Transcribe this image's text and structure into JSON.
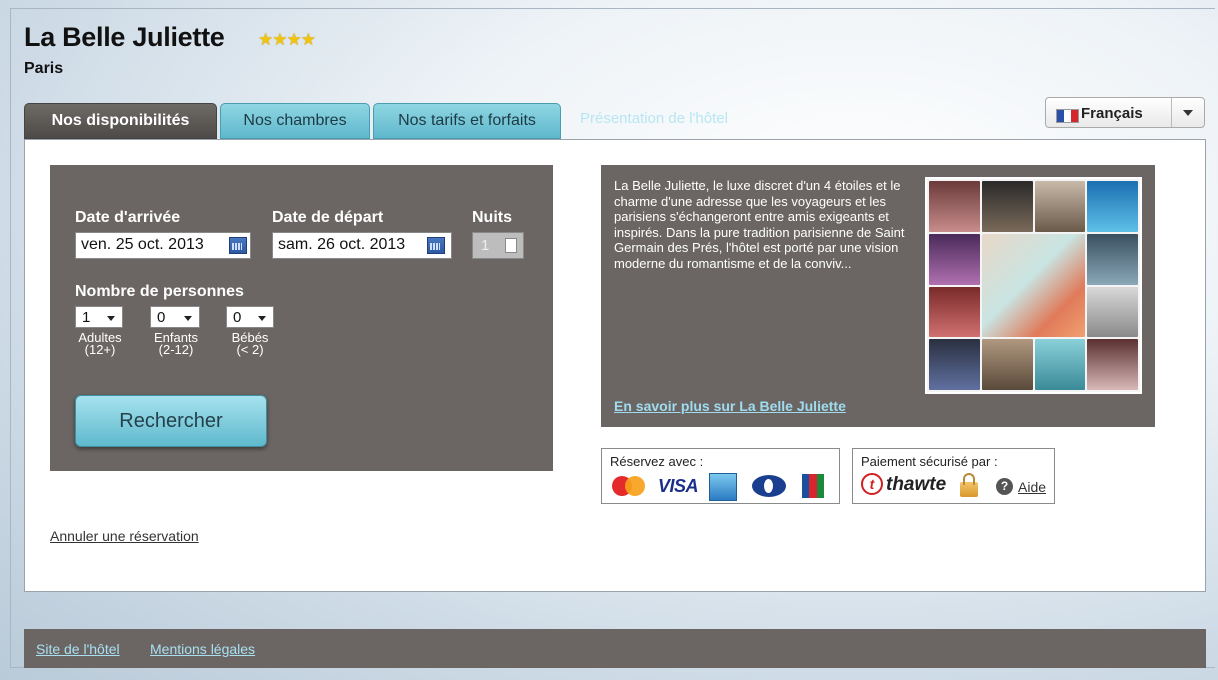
{
  "hotel": {
    "name": "La Belle Juliette",
    "stars": "★★★★",
    "star_count": 4,
    "city": "Paris"
  },
  "tabs": [
    {
      "label": "Nos disponibilités",
      "active": true
    },
    {
      "label": "Nos chambres",
      "active": false
    },
    {
      "label": "Nos tarifs et forfaits",
      "active": false
    },
    {
      "label": "Présentation de l'hôtel",
      "active": false
    }
  ],
  "language": {
    "selected": "Français"
  },
  "search": {
    "arrival_label": "Date d'arrivée",
    "arrival_value": "ven. 25 oct. 2013",
    "departure_label": "Date de départ",
    "departure_value": "sam. 26 oct. 2013",
    "nights_label": "Nuits",
    "nights_value": "1",
    "persons_label": "Nombre de personnes",
    "adults": {
      "value": "1",
      "label_line1": "Adultes",
      "label_line2": "(12+)"
    },
    "children": {
      "value": "0",
      "label_line1": "Enfants",
      "label_line2": "(2-12)"
    },
    "babies": {
      "value": "0",
      "label_line1": "Bébés",
      "label_line2": "(< 2)"
    },
    "search_button": "Rechercher"
  },
  "cancel_link": "Annuler une réservation",
  "description": {
    "text": "La Belle Juliette, le luxe discret d'un 4 étoiles et le charme d'une adresse que les voyageurs et les parisiens s'échangeront entre amis exigeants et inspirés. Dans la pure tradition parisienne de Saint Germain des Prés, l'hôtel est porté par une vision moderne du romantisme et de la conviv...",
    "more_link": "En savoir plus sur La Belle Juliette"
  },
  "payment": {
    "book_with_label": "Réservez avec :",
    "cards": [
      "mastercard-icon",
      "visa-icon",
      "amex-icon",
      "diners-icon",
      "jcb-icon"
    ],
    "visa_text": "VISA",
    "secure_label": "Paiement sécurisé par :",
    "thawte_letter": "t",
    "thawte_text": "thawte",
    "help_symbol": "?",
    "help_link": "Aide"
  },
  "footer": {
    "site_link": "Site de l'hôtel",
    "legal_link": "Mentions légales"
  },
  "colors": {
    "tab_active": "#5a5653",
    "tab_inactive": "#74c6d8",
    "panel_dark": "#6b6663",
    "link_light": "#a9e0f1"
  }
}
